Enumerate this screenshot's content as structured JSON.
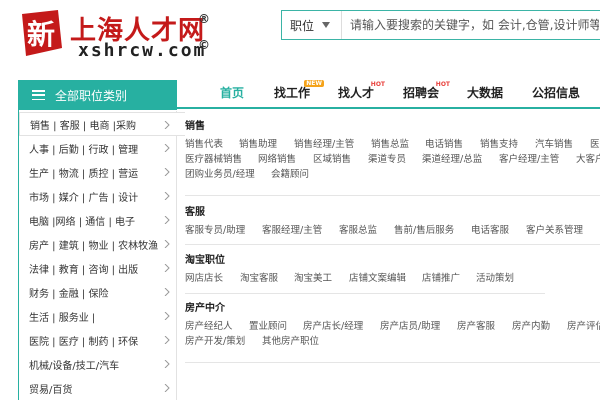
{
  "logo": {
    "cn_text": "上海人才网",
    "en_text": "xshrcw.com",
    "registered_mark": "®",
    "copyright_mark": "©",
    "badge_char": "新"
  },
  "search": {
    "type_selected": "职位",
    "placeholder": "请输入要搜索的关键字，如 会计,仓管,设计师等"
  },
  "nav": {
    "category_button": "全部职位类别",
    "items": [
      {
        "label": "首页"
      },
      {
        "label": "找工作",
        "badge": "NEW"
      },
      {
        "label": "找人才",
        "badge": "HOT"
      },
      {
        "label": "招聘会",
        "badge": "HOT"
      },
      {
        "label": "大数据"
      },
      {
        "label": "公招信息"
      }
    ]
  },
  "sidebar": {
    "items": [
      {
        "label": "销售 | 客服 | 电商 |采购"
      },
      {
        "label": "人事 | 后勤 | 行政 | 管理"
      },
      {
        "label": "生产 | 物流 | 质控 | 营运"
      },
      {
        "label": "市场 | 媒介 | 广告 | 设计"
      },
      {
        "label": "电脑 |网络 | 通信 | 电子"
      },
      {
        "label": "房产 | 建筑 | 物业 | 农林牧渔"
      },
      {
        "label": "法律 | 教育 | 咨询 | 出版"
      },
      {
        "label": "财务 | 金融 | 保险"
      },
      {
        "label": "生活 | 服务业 |"
      },
      {
        "label": "医院 | 医疗 | 制药 | 环保"
      },
      {
        "label": "机械/设备/技工/汽车"
      },
      {
        "label": "贸易/百货"
      }
    ]
  },
  "panel": {
    "groups": [
      {
        "title": "销售",
        "rows": [
          [
            "销售代表",
            "销售助理",
            "销售经理/主管",
            "销售总监",
            "电话销售",
            "销售支持",
            "汽车销售",
            "医药代表"
          ],
          [
            "医疗器械销售",
            "网络销售",
            "区域销售",
            "渠道专员",
            "渠道经理/总监",
            "客户经理/主管",
            "大客户经理"
          ],
          [
            "团购业务员/经理",
            "会籍顾问"
          ]
        ]
      },
      {
        "title": "客服",
        "rows": [
          [
            "客服专员/助理",
            "客服经理/主管",
            "客服总监",
            "售前/售后服务",
            "电话客服",
            "客户关系管理"
          ]
        ]
      },
      {
        "title": "淘宝职位",
        "rows": [
          [
            "网店店长",
            "淘宝客服",
            "淘宝美工",
            "店铺文案编辑",
            "店铺推广",
            "活动策划"
          ]
        ]
      },
      {
        "title": "房产中介",
        "rows": [
          [
            "房产经纪人",
            "置业顾问",
            "房产店长/经理",
            "房产店员/助理",
            "房产客服",
            "房产内勤",
            "房产评估师"
          ],
          [
            "房产开发/策划",
            "其他房产职位"
          ]
        ]
      }
    ]
  },
  "colors": {
    "accent": "#27b0a1",
    "brand_red": "#c41a1a",
    "new_badge": "#f5a31a",
    "hot_badge": "#e8423d"
  }
}
